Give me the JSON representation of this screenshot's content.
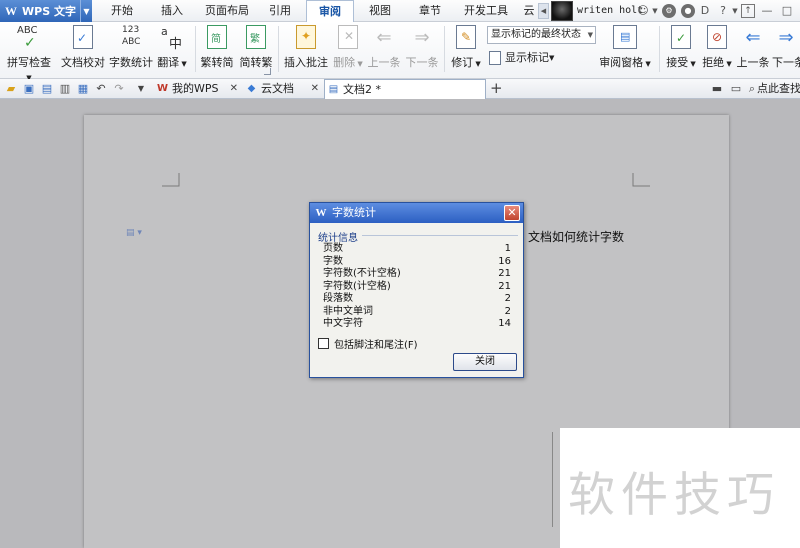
{
  "app": {
    "logo": "W",
    "title": "WPS 文字"
  },
  "menu": {
    "tabs": [
      "开始",
      "插入",
      "页面布局",
      "引用",
      "审阅",
      "视图",
      "章节",
      "开发工具",
      "云"
    ],
    "active_tab": "审阅",
    "user_name": "writen holt"
  },
  "ribbon": {
    "spellcheck": "拼写检查",
    "doc_proof": "文档校对",
    "word_count": "字数统计",
    "translate": "翻译",
    "to_simplified": "繁转简",
    "to_traditional": "简转繁",
    "insert_comment": "插入批注",
    "delete": "删除",
    "prev_item": "上一条",
    "next_item": "下一条",
    "track_changes": "修订",
    "markup_select": "显示标记的最终状态",
    "show_markup": "显示标记",
    "review_pane": "审阅窗格",
    "accept": "接受",
    "reject": "拒绝",
    "prev_change": "上一条",
    "next_change": "下一条"
  },
  "doc_tabs": [
    {
      "label": "我的WPS"
    },
    {
      "label": "云文档"
    },
    {
      "label": "文档2 *"
    }
  ],
  "search_hint": "点此查找",
  "document": {
    "body_line": "文档如何统计字数"
  },
  "dialog": {
    "title": "字数统计",
    "group_title": "统计信息",
    "stats": [
      {
        "label": "页数",
        "value": "1"
      },
      {
        "label": "字数",
        "value": "16"
      },
      {
        "label": "字符数(不计空格)",
        "value": "21"
      },
      {
        "label": "字符数(计空格)",
        "value": "21"
      },
      {
        "label": "段落数",
        "value": "2"
      },
      {
        "label": "非中文单词",
        "value": "2"
      },
      {
        "label": "中文字符",
        "value": "14"
      }
    ],
    "checkbox_label": "包括脚注和尾注(F)",
    "checkbox_checked": false,
    "close_label": "关闭"
  },
  "watermark": {
    "text": "软件技巧"
  },
  "colors": {
    "accent": "#2c5fc2",
    "active_tab_text": "#1a56a6",
    "close_red": "#c0452f"
  }
}
